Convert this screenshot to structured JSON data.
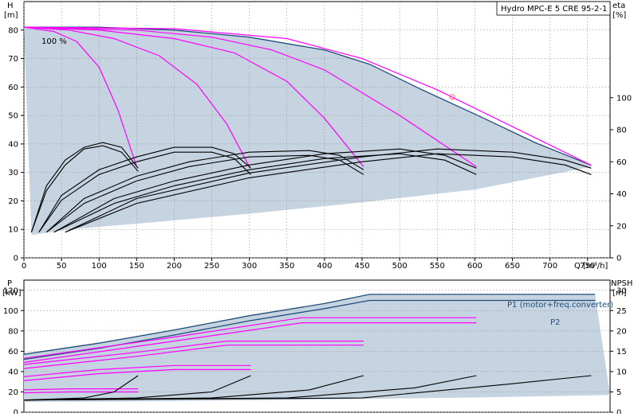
{
  "title": "Hydro MPC-E 5 CRE 95-2-1",
  "colors": {
    "envelope_fill": "#c6d3e0",
    "envelope_line": "#1f4e79",
    "speed_curve": "#ff00ff",
    "curve": "#000000",
    "operating_point": "#ff6666"
  },
  "chart_data": [
    {
      "type": "line",
      "name": "top",
      "x_label": "Q [m³/h]",
      "x_ticks": [
        0,
        50,
        100,
        150,
        200,
        250,
        300,
        350,
        400,
        450,
        500,
        550,
        600,
        650,
        700,
        750
      ],
      "xlim": [
        0,
        780
      ],
      "left_axis": {
        "label_line1": "H",
        "label_line2": "[m]",
        "ticks": [
          0,
          10,
          20,
          30,
          40,
          50,
          60,
          70,
          80
        ],
        "ylim": [
          0,
          90
        ]
      },
      "right_axis": {
        "label_line1": "eta",
        "label_line2": "[%]",
        "ticks": [
          0,
          20,
          40,
          60,
          80,
          100
        ],
        "ylim": [
          0,
          160
        ]
      },
      "annotation": "100 %",
      "operating_point": {
        "x": 570,
        "y": 56.5
      },
      "envelope_lower": [
        [
          10,
          8
        ],
        [
          60,
          10
        ],
        [
          150,
          12
        ],
        [
          300,
          15.5
        ],
        [
          450,
          19.5
        ],
        [
          600,
          24
        ],
        [
          755,
          32
        ]
      ],
      "series": [
        {
          "role": "envelope",
          "points": [
            [
              0,
              81
            ],
            [
              100,
              81
            ],
            [
              200,
              80
            ],
            [
              300,
              77.5
            ],
            [
              400,
              73
            ],
            [
              460,
              68
            ],
            [
              530,
              59
            ],
            [
              600,
              50.5
            ],
            [
              680,
              40.5
            ],
            [
              755,
              32.5
            ]
          ]
        },
        {
          "role": "speed",
          "points": [
            [
              0,
              81
            ],
            [
              40,
              79.5
            ],
            [
              70,
              76
            ],
            [
              100,
              67
            ],
            [
              125,
              52
            ],
            [
              150,
              32
            ]
          ]
        },
        {
          "role": "speed",
          "points": [
            [
              0,
              81
            ],
            [
              60,
              80
            ],
            [
              120,
              77
            ],
            [
              180,
              71
            ],
            [
              230,
              61
            ],
            [
              270,
              47
            ],
            [
              300,
              32
            ]
          ]
        },
        {
          "role": "speed",
          "points": [
            [
              0,
              81
            ],
            [
              100,
              80
            ],
            [
              200,
              77
            ],
            [
              280,
              72
            ],
            [
              350,
              62
            ],
            [
              400,
              49
            ],
            [
              452,
              32
            ]
          ]
        },
        {
          "role": "speed",
          "points": [
            [
              0,
              81
            ],
            [
              150,
              80
            ],
            [
              250,
              77.5
            ],
            [
              330,
              73
            ],
            [
              400,
              66
            ],
            [
              500,
              50
            ],
            [
              602,
              32
            ]
          ]
        },
        {
          "role": "speed",
          "points": [
            [
              0,
              81
            ],
            [
              200,
              80.5
            ],
            [
              350,
              77
            ],
            [
              450,
              70
            ],
            [
              550,
              59
            ],
            [
              755,
              32.5
            ]
          ]
        },
        {
          "role": "eff",
          "points": [
            [
              10,
              16
            ],
            [
              30,
              42
            ],
            [
              55,
              58
            ],
            [
              80,
              68
            ],
            [
              105,
              70
            ],
            [
              130,
              66
            ],
            [
              152,
              54
            ]
          ]
        },
        {
          "role": "eff",
          "points": [
            [
              10,
              16
            ],
            [
              30,
              45
            ],
            [
              55,
              61
            ],
            [
              80,
              69
            ],
            [
              105,
              72
            ],
            [
              130,
              69
            ],
            [
              152,
              56
            ]
          ]
        },
        {
          "role": "eff",
          "points": [
            [
              20,
              16
            ],
            [
              50,
              36
            ],
            [
              100,
              52
            ],
            [
              150,
              60
            ],
            [
              200,
              66
            ],
            [
              250,
              66
            ],
            [
              280,
              62
            ],
            [
              302,
              52
            ]
          ]
        },
        {
          "role": "eff",
          "points": [
            [
              20,
              16
            ],
            [
              50,
              39
            ],
            [
              100,
              55
            ],
            [
              150,
              63
            ],
            [
              200,
              69
            ],
            [
              250,
              69
            ],
            [
              280,
              65
            ],
            [
              302,
              56
            ]
          ]
        },
        {
          "role": "eff",
          "points": [
            [
              30,
              16
            ],
            [
              80,
              34
            ],
            [
              150,
              48
            ],
            [
              220,
              57
            ],
            [
              300,
              63
            ],
            [
              380,
              64
            ],
            [
              420,
              61
            ],
            [
              452,
              52
            ]
          ]
        },
        {
          "role": "eff",
          "points": [
            [
              30,
              16
            ],
            [
              80,
              37
            ],
            [
              150,
              51
            ],
            [
              220,
              60
            ],
            [
              300,
              66
            ],
            [
              380,
              67
            ],
            [
              420,
              64
            ],
            [
              452,
              55
            ]
          ]
        },
        {
          "role": "eff",
          "points": [
            [
              40,
              16
            ],
            [
              120,
              34
            ],
            [
              200,
              45
            ],
            [
              300,
              55
            ],
            [
              400,
              62
            ],
            [
              500,
              65
            ],
            [
              560,
              61
            ],
            [
              602,
              52
            ]
          ]
        },
        {
          "role": "eff",
          "points": [
            [
              40,
              16
            ],
            [
              120,
              37
            ],
            [
              200,
              48
            ],
            [
              300,
              58
            ],
            [
              400,
              65
            ],
            [
              500,
              68
            ],
            [
              560,
              64
            ],
            [
              602,
              56
            ]
          ]
        },
        {
          "role": "eff",
          "points": [
            [
              55,
              16
            ],
            [
              150,
              34
            ],
            [
              300,
              50
            ],
            [
              450,
              60
            ],
            [
              550,
              65
            ],
            [
              650,
              63
            ],
            [
              720,
              58
            ],
            [
              755,
              52
            ]
          ]
        },
        {
          "role": "eff",
          "points": [
            [
              55,
              16
            ],
            [
              150,
              37
            ],
            [
              300,
              53
            ],
            [
              450,
              63
            ],
            [
              550,
              68
            ],
            [
              650,
              66
            ],
            [
              720,
              61
            ],
            [
              755,
              56
            ]
          ]
        }
      ]
    },
    {
      "type": "line",
      "name": "bottom",
      "xlim": [
        0,
        780
      ],
      "left_axis": {
        "label_line1": "P",
        "label_line2": "[kW]",
        "ticks": [
          0,
          20,
          40,
          60,
          80,
          100,
          120
        ],
        "ylim": [
          0,
          130
        ]
      },
      "right_axis": {
        "label_line1": "NPSH",
        "label_line2": "[m]",
        "ticks": [
          0,
          5,
          10,
          15,
          20,
          25,
          30
        ],
        "ylim": [
          0,
          32.5
        ]
      },
      "labels": [
        "P1 (motor+freq.converter)",
        "P2"
      ],
      "envelope_lower": [
        [
          0,
          10
        ],
        [
          200,
          11
        ],
        [
          400,
          12.5
        ],
        [
          600,
          14.5
        ],
        [
          780,
          17
        ]
      ],
      "series": [
        {
          "role": "envelope",
          "points": [
            [
              0,
              57
            ],
            [
              100,
              68
            ],
            [
              200,
              81
            ],
            [
              300,
              95
            ],
            [
              400,
              107
            ],
            [
              460,
              116
            ],
            [
              760,
              116
            ]
          ]
        },
        {
          "role": "p2_env",
          "points": [
            [
              0,
              52
            ],
            [
              100,
              63
            ],
            [
              200,
              76
            ],
            [
              300,
              90
            ],
            [
              400,
              102
            ],
            [
              460,
              110
            ],
            [
              760,
              110
            ]
          ]
        },
        {
          "role": "speed",
          "points": [
            [
              0,
              22
            ],
            [
              60,
              23
            ],
            [
              152,
              23
            ]
          ]
        },
        {
          "role": "speed",
          "points": [
            [
              0,
              19
            ],
            [
              60,
              20
            ],
            [
              152,
              20
            ]
          ]
        },
        {
          "role": "speed",
          "points": [
            [
              0,
              35
            ],
            [
              100,
              42
            ],
            [
              200,
              46
            ],
            [
              302,
              46
            ]
          ]
        },
        {
          "role": "speed",
          "points": [
            [
              0,
              31
            ],
            [
              100,
              38
            ],
            [
              200,
              42
            ],
            [
              302,
              42
            ]
          ]
        },
        {
          "role": "speed",
          "points": [
            [
              0,
              47
            ],
            [
              150,
              59
            ],
            [
              270,
              70
            ],
            [
              452,
              70
            ]
          ]
        },
        {
          "role": "speed",
          "points": [
            [
              0,
              43
            ],
            [
              150,
              55
            ],
            [
              270,
              66
            ],
            [
              452,
              66
            ]
          ]
        },
        {
          "role": "speed",
          "points": [
            [
              0,
              53
            ],
            [
              200,
              74
            ],
            [
              370,
              93
            ],
            [
              602,
              93
            ]
          ]
        },
        {
          "role": "speed",
          "points": [
            [
              0,
              49
            ],
            [
              200,
              70
            ],
            [
              370,
              88
            ],
            [
              602,
              88
            ]
          ]
        },
        {
          "role": "npsh",
          "points": [
            [
              0,
              3
            ],
            [
              80,
              3.5
            ],
            [
              120,
              5
            ],
            [
              152,
              9
            ]
          ]
        },
        {
          "role": "npsh",
          "points": [
            [
              0,
              3
            ],
            [
              150,
              3.5
            ],
            [
              250,
              5
            ],
            [
              302,
              9
            ]
          ]
        },
        {
          "role": "npsh",
          "points": [
            [
              0,
              3
            ],
            [
              250,
              3.5
            ],
            [
              380,
              5.5
            ],
            [
              452,
              9
            ]
          ]
        },
        {
          "role": "npsh",
          "points": [
            [
              0,
              3
            ],
            [
              350,
              3.5
            ],
            [
              520,
              6
            ],
            [
              602,
              9
            ]
          ]
        },
        {
          "role": "npsh",
          "points": [
            [
              0,
              3
            ],
            [
              450,
              3.5
            ],
            [
              650,
              7
            ],
            [
              755,
              9
            ]
          ]
        }
      ]
    }
  ]
}
